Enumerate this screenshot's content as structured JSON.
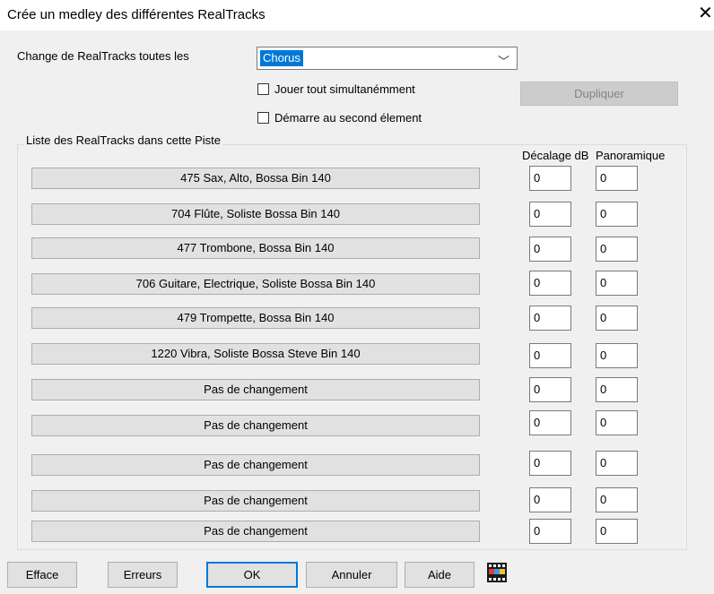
{
  "window": {
    "title": "Crée un medley des différentes RealTracks",
    "close_glyph": "✕"
  },
  "change": {
    "label": "Change de RealTracks toutes les",
    "selected": "Chorus",
    "arrow_glyph": "﹀"
  },
  "options": {
    "play_all": "Jouer tout simultanémment",
    "start_second": "Démarre au second élement",
    "duplicate": "Dupliquer"
  },
  "list": {
    "title": "Liste des RealTracks dans cette Piste",
    "col_offset": "Décalage dB",
    "col_pan": "Panoramique",
    "rows": [
      {
        "name": "475 Sax, Alto, Bossa Bin 140",
        "offset": "0",
        "pan": "0"
      },
      {
        "name": "704 Flûte, Soliste Bossa Bin 140",
        "offset": "0",
        "pan": "0"
      },
      {
        "name": "477 Trombone, Bossa Bin 140",
        "offset": "0",
        "pan": "0"
      },
      {
        "name": "706 Guitare, Electrique, Soliste Bossa Bin 140",
        "offset": "0",
        "pan": "0"
      },
      {
        "name": "479 Trompette, Bossa Bin 140",
        "offset": "0",
        "pan": "0"
      },
      {
        "name": "1220 Vibra, Soliste Bossa Steve Bin 140",
        "offset": "0",
        "pan": "0"
      },
      {
        "name": "Pas de changement",
        "offset": "0",
        "pan": "0"
      },
      {
        "name": "Pas de changement",
        "offset": "0",
        "pan": "0"
      },
      {
        "name": "Pas de changement",
        "offset": "0",
        "pan": "0"
      },
      {
        "name": "Pas de changement",
        "offset": "0",
        "pan": "0"
      },
      {
        "name": "Pas de changement",
        "offset": "0",
        "pan": "0"
      }
    ]
  },
  "buttons": {
    "clear": "Efface",
    "errors": "Erreurs",
    "ok": "OK",
    "cancel": "Annuler",
    "help": "Aide",
    "video_icon": "film-clapper-icon"
  },
  "colors": {
    "selection": "#0078d7",
    "dialog_bg": "#f0f0f0",
    "button_bg": "#e1e1e1"
  }
}
